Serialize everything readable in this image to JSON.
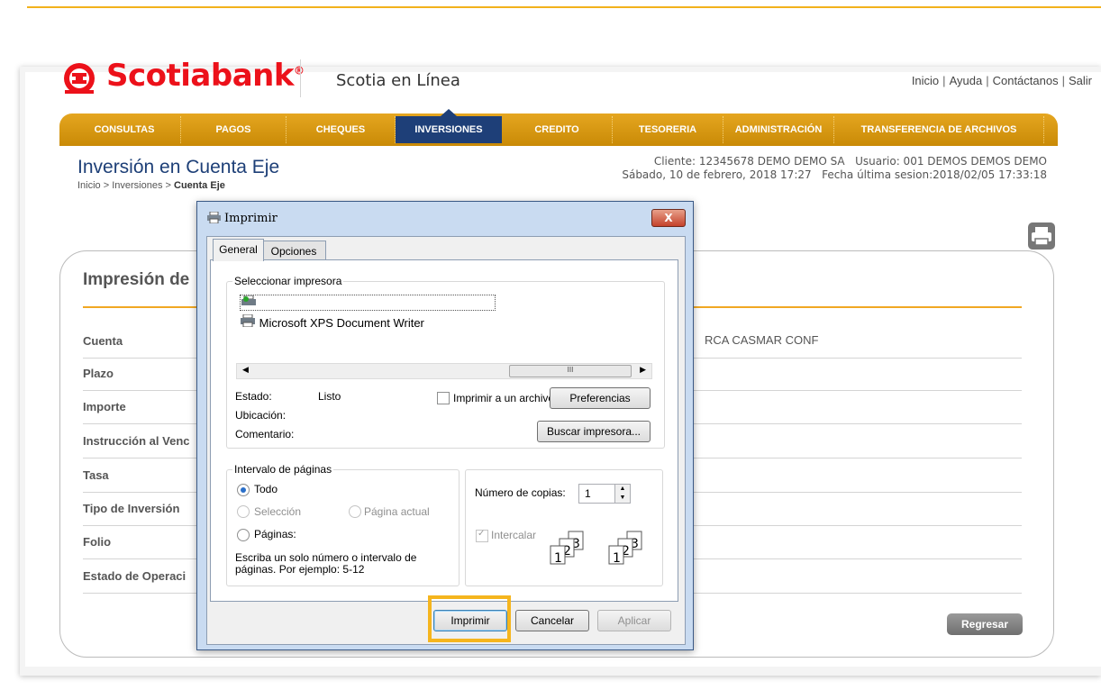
{
  "header": {
    "brand": "Scotiabank",
    "brand_mark": "®",
    "subtitle": "Scotia en Línea",
    "links": [
      "Inicio",
      "Ayuda",
      "Contáctanos",
      "Salir"
    ],
    "link_sep": "|"
  },
  "nav": {
    "items": [
      "CONSULTAS",
      "PAGOS",
      "CHEQUES",
      "INVERSIONES",
      "CREDITO",
      "TESORERIA",
      "ADMINISTRACIÓN",
      "TRANSFERENCIA DE ARCHIVOS"
    ],
    "active": "INVERSIONES"
  },
  "page": {
    "title": "Inversión en Cuenta Eje",
    "breadcrumb_prefix": "Inicio > Inversiones > ",
    "breadcrumb_current": "Cuenta Eje",
    "cliente": "Cliente: 12345678 DEMO DEMO SA",
    "usuario": "Usuario: 001 DEMOS DEMOS DEMO",
    "fecha": "Sábado, 10 de febrero, 2018 17:27",
    "ultima_sesion": "Fecha última sesion:2018/02/05 17:33:18"
  },
  "panel": {
    "title": "Impresión de",
    "fields": [
      {
        "label": "Cuenta",
        "value": "RCA CASMAR CONF"
      },
      {
        "label": "Plazo",
        "value": ""
      },
      {
        "label": "Importe",
        "value": ""
      },
      {
        "label": "Instrucción al Venc",
        "value": ""
      },
      {
        "label": "Tasa",
        "value": ""
      },
      {
        "label": "Tipo de Inversión",
        "value": ""
      },
      {
        "label": "Folio",
        "value": ""
      },
      {
        "label": "Estado de Operaci",
        "value": ""
      }
    ],
    "back_button": "Regresar"
  },
  "dialog": {
    "title": "Imprimir",
    "close": "X",
    "tabs": [
      "General",
      "Opciones"
    ],
    "select_printer_label": "Seleccionar impresora",
    "printers": [
      "",
      "Microsoft XPS Document Writer"
    ],
    "scroll_thumb": "III",
    "estado_label": "Estado:",
    "estado_value": "Listo",
    "ubicacion_label": "Ubicación:",
    "comentario_label": "Comentario:",
    "print_to_file": "Imprimir a un archivo",
    "preferences": "Preferencias",
    "find_printer": "Buscar impresora...",
    "range_group": "Intervalo de páginas",
    "range_all": "Todo",
    "range_selection": "Selección",
    "range_current": "Página actual",
    "range_pages": "Páginas:",
    "range_hint": "Escriba un solo número o intervalo de páginas. Por ejemplo: 5-12",
    "copies_label": "Número de copias:",
    "copies_value": "1",
    "collate": "Intercalar",
    "btn_print": "Imprimir",
    "btn_cancel": "Cancelar",
    "btn_apply": "Aplicar"
  },
  "colors": {
    "brand_red": "#ec111a",
    "nav_gold": "#e5a620",
    "nav_active": "#1e3f78",
    "title_blue": "#1d3f77",
    "highlight": "#f5b51e"
  }
}
